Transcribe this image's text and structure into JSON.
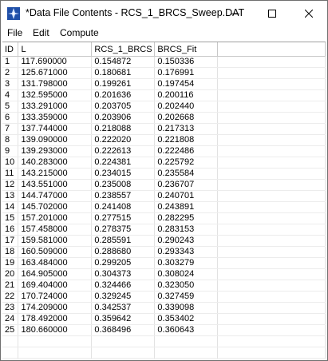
{
  "window": {
    "title": "*Data File Contents - RCS_1_BRCS_Sweep.DAT"
  },
  "menu": {
    "items": [
      "File",
      "Edit",
      "Compute"
    ]
  },
  "table": {
    "columns": [
      "ID",
      "L",
      "RCS_1_BRCS",
      "BRCS_Fit"
    ],
    "rows": [
      [
        "1",
        "117.690000",
        "0.154872",
        "0.150336"
      ],
      [
        "2",
        "125.671000",
        "0.180681",
        "0.176991"
      ],
      [
        "3",
        "131.798000",
        "0.199261",
        "0.197454"
      ],
      [
        "4",
        "132.595000",
        "0.201636",
        "0.200116"
      ],
      [
        "5",
        "133.291000",
        "0.203705",
        "0.202440"
      ],
      [
        "6",
        "133.359000",
        "0.203906",
        "0.202668"
      ],
      [
        "7",
        "137.744000",
        "0.218088",
        "0.217313"
      ],
      [
        "8",
        "139.090000",
        "0.222020",
        "0.221808"
      ],
      [
        "9",
        "139.293000",
        "0.222613",
        "0.222486"
      ],
      [
        "10",
        "140.283000",
        "0.224381",
        "0.225792"
      ],
      [
        "11",
        "143.215000",
        "0.234015",
        "0.235584"
      ],
      [
        "12",
        "143.551000",
        "0.235008",
        "0.236707"
      ],
      [
        "13",
        "144.747000",
        "0.238557",
        "0.240701"
      ],
      [
        "14",
        "145.702000",
        "0.241408",
        "0.243891"
      ],
      [
        "15",
        "157.201000",
        "0.277515",
        "0.282295"
      ],
      [
        "16",
        "157.458000",
        "0.278375",
        "0.283153"
      ],
      [
        "17",
        "159.581000",
        "0.285591",
        "0.290243"
      ],
      [
        "18",
        "160.509000",
        "0.288680",
        "0.293343"
      ],
      [
        "19",
        "163.484000",
        "0.299205",
        "0.303279"
      ],
      [
        "20",
        "164.905000",
        "0.304373",
        "0.308024"
      ],
      [
        "21",
        "169.404000",
        "0.324466",
        "0.323050"
      ],
      [
        "22",
        "170.724000",
        "0.329245",
        "0.327459"
      ],
      [
        "23",
        "174.209000",
        "0.342537",
        "0.339098"
      ],
      [
        "24",
        "178.492000",
        "0.359642",
        "0.353402"
      ],
      [
        "25",
        "180.660000",
        "0.368496",
        "0.360643"
      ]
    ]
  }
}
